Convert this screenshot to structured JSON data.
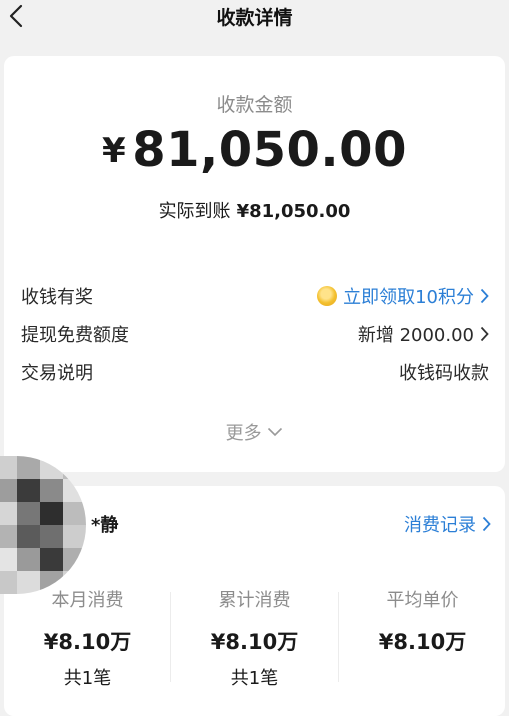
{
  "header": {
    "title": "收款详情"
  },
  "summary": {
    "amount_label": "收款金额",
    "currency_symbol": "¥",
    "amount": "81,050.00",
    "actual_label": "实际到账",
    "actual_amount": "¥81,050.00"
  },
  "details": [
    {
      "label": "收钱有奖",
      "value": "立即领取10积分",
      "icon": "coin-icon",
      "link": true
    },
    {
      "label": "提现免费额度",
      "value": "新增 2000.00",
      "link": true
    },
    {
      "label": "交易说明",
      "value": "收钱码收款",
      "link": false
    }
  ],
  "more_label": "更多",
  "payer": {
    "name": "*静",
    "records_label": "消费记录"
  },
  "stats": [
    {
      "title": "本月消费",
      "value": "¥8.10万",
      "count": "共1笔"
    },
    {
      "title": "累计消费",
      "value": "¥8.10万",
      "count": "共1笔"
    },
    {
      "title": "平均单价",
      "value": "¥8.10万",
      "count": ""
    }
  ],
  "colors": {
    "link": "#2c7fd6",
    "muted": "#8c8c8c",
    "background": "#f1f1f1"
  }
}
